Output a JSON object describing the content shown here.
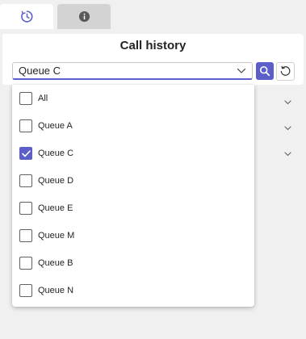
{
  "tabs": [
    {
      "icon": "history-clock-icon",
      "active": true
    },
    {
      "icon": "info-icon",
      "active": false
    }
  ],
  "panel": {
    "title": "Call history",
    "queue_select": {
      "value": "Queue C"
    }
  },
  "dropdown": {
    "options": [
      {
        "label": "All",
        "checked": false
      },
      {
        "label": "Queue A",
        "checked": false
      },
      {
        "label": "Queue C",
        "checked": true
      },
      {
        "label": "Queue D",
        "checked": false
      },
      {
        "label": "Queue E",
        "checked": false
      },
      {
        "label": "Queue M",
        "checked": false
      },
      {
        "label": "Queue B",
        "checked": false
      },
      {
        "label": "Queue N",
        "checked": false
      }
    ]
  },
  "colors": {
    "accent": "#5b5fc7",
    "background": "#f0f0f0",
    "tab_inactive": "#d3d3d3"
  }
}
